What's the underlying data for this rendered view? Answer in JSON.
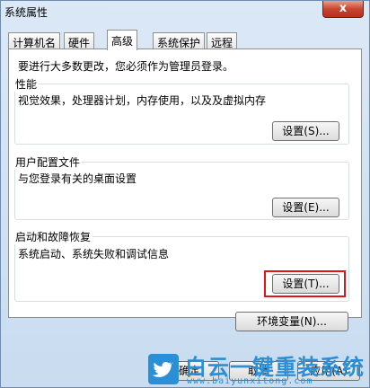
{
  "window": {
    "title": "系统属性",
    "close_label": "x"
  },
  "tabs": [
    {
      "label": "计算机名"
    },
    {
      "label": "硬件"
    },
    {
      "label": "高级"
    },
    {
      "label": "系统保护"
    },
    {
      "label": "远程"
    }
  ],
  "admin_note": "要进行大多数更改，您必须作为管理员登录。",
  "performance": {
    "title": "性能",
    "description": "视觉效果，处理器计划，内存使用，以及及虚拟内存",
    "button": "设置(S)..."
  },
  "user_profiles": {
    "title": "用户配置文件",
    "description": "与您登录有关的桌面设置",
    "button": "设置(E)..."
  },
  "startup_recovery": {
    "title": "启动和故障恢复",
    "description": "系统启动、系统失败和调试信息",
    "button": "设置(T)..."
  },
  "env_button": "环境变量(N)...",
  "footer": {
    "ok": "确定",
    "cancel": "取消",
    "apply": "应用(A)"
  },
  "watermark": {
    "text": "白云一键重装系统",
    "url": "www.baiyunxitong.com"
  }
}
